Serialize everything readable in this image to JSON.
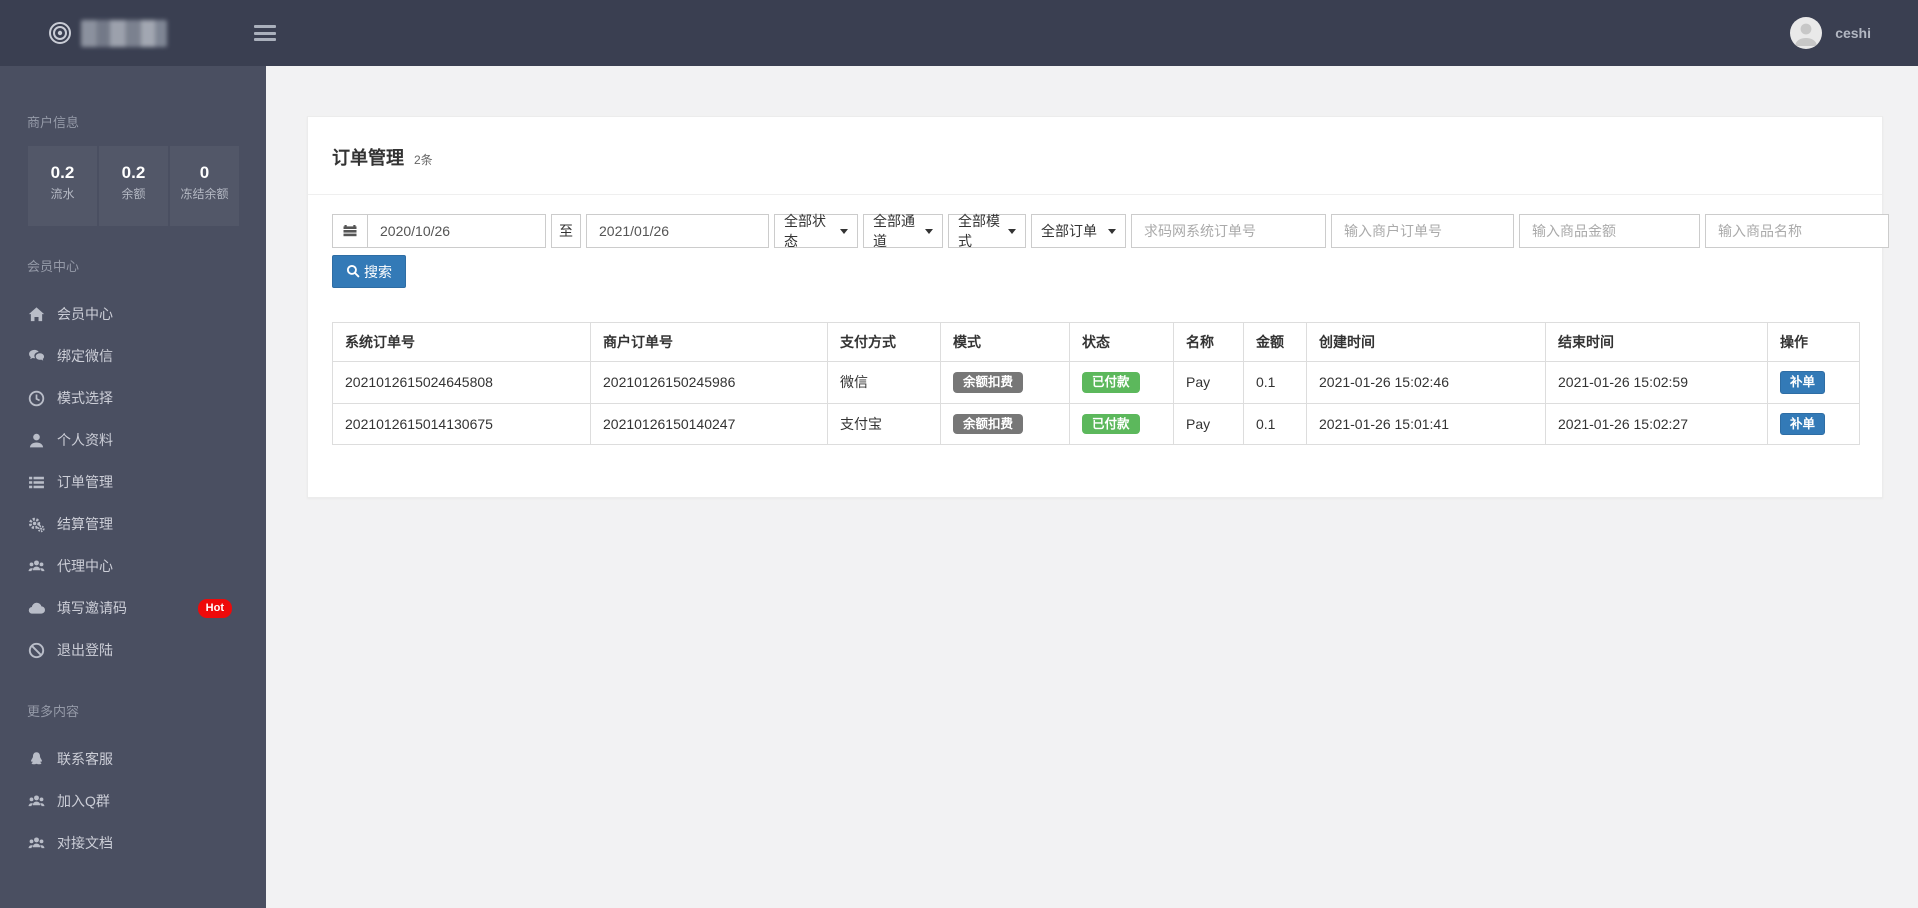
{
  "navbar": {
    "username": "ceshi"
  },
  "sidebar": {
    "sections": {
      "merchant": "商户信息",
      "member": "会员中心",
      "more": "更多内容"
    },
    "stats": [
      {
        "value": "0.2",
        "label": "流水"
      },
      {
        "value": "0.2",
        "label": "余额"
      },
      {
        "value": "0",
        "label": "冻结余额"
      }
    ],
    "menu": [
      {
        "label": "会员中心",
        "icon": "home-icon"
      },
      {
        "label": "绑定微信",
        "icon": "wechat-icon"
      },
      {
        "label": "模式选择",
        "icon": "clock-icon"
      },
      {
        "label": "个人资料",
        "icon": "user-icon"
      },
      {
        "label": "订单管理",
        "icon": "list-icon"
      },
      {
        "label": "结算管理",
        "icon": "cogs-icon"
      },
      {
        "label": "代理中心",
        "icon": "users-icon"
      },
      {
        "label": "填写邀请码",
        "icon": "cloud-icon",
        "badge": "Hot"
      },
      {
        "label": "退出登陆",
        "icon": "ban-icon"
      }
    ],
    "more_menu": [
      {
        "label": "联系客服",
        "icon": "qq-icon"
      },
      {
        "label": "加入Q群",
        "icon": "users-icon"
      },
      {
        "label": "对接文档",
        "icon": "users-icon"
      }
    ]
  },
  "page": {
    "title": "订单管理",
    "count": "2条"
  },
  "filters": {
    "date_from": "2020/10/26",
    "to_label": "至",
    "date_to": "2021/01/26",
    "selects": [
      "全部状态",
      "全部通道",
      "全部模式",
      "全部订单"
    ],
    "text_inputs": [
      "求码网系统订单号",
      "输入商户订单号",
      "输入商品金额",
      "输入商品名称"
    ],
    "search_label": "搜索"
  },
  "table": {
    "columns": [
      "系统订单号",
      "商户订单号",
      "支付方式",
      "模式",
      "状态",
      "名称",
      "金额",
      "创建时间",
      "结束时间",
      "操作"
    ],
    "rows": [
      {
        "system_order_no": "2021012615024645808",
        "merchant_order_no": "20210126150245986",
        "pay_method": "微信",
        "mode": "余额扣费",
        "status": "已付款",
        "name": "Pay",
        "amount": "0.1",
        "created_at": "2021-01-26 15:02:46",
        "ended_at": "2021-01-26 15:02:59",
        "action": "补单"
      },
      {
        "system_order_no": "2021012615014130675",
        "merchant_order_no": "20210126150140247",
        "pay_method": "支付宝",
        "mode": "余额扣费",
        "status": "已付款",
        "name": "Pay",
        "amount": "0.1",
        "created_at": "2021-01-26 15:01:41",
        "ended_at": "2021-01-26 15:02:27",
        "action": "补单"
      }
    ]
  },
  "colors": {
    "navbar_bg": "#3a3f51",
    "sidebar_bg": "#4a4f61",
    "accent_blue": "#337ab7",
    "badge_green": "#5cb85c",
    "badge_gray": "#777777",
    "hot_red": "#ee0a0a"
  }
}
